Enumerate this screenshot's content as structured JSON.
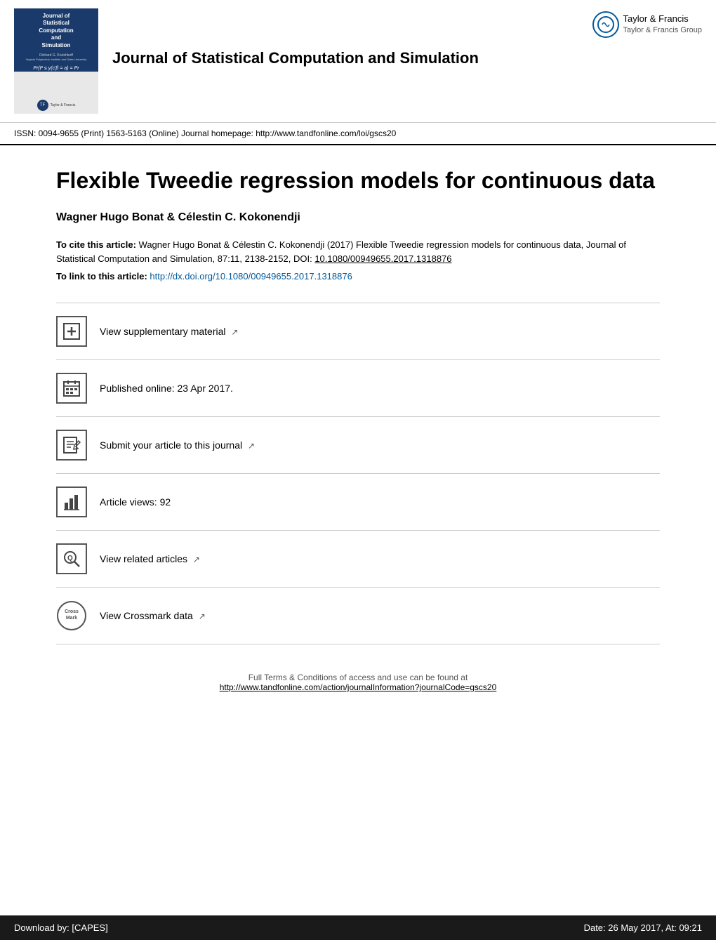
{
  "header": {
    "journal_name": "Journal of Statistical Computation and Simulation",
    "taylor_francis_label": "Taylor & Francis",
    "taylor_francis_group": "Taylor & Francis Group",
    "issn_text": "ISSN: 0094-9655 (Print) 1563-5163 (Online) Journal homepage: http://www.tandfonline.com/loi/gscs20",
    "journal_homepage_url": "http://www.tandfonline.com/loi/gscs20",
    "cover": {
      "title_line1": "Journal of",
      "title_line2": "Statistical",
      "title_line3": "Computation",
      "title_line4": "and",
      "title_line5": "Simulation"
    }
  },
  "article": {
    "title": "Flexible Tweedie regression models for continuous data",
    "authors": "Wagner Hugo Bonat & Célestin C. Kokonendji",
    "cite_label": "To cite this article:",
    "cite_text": "Wagner Hugo Bonat & Célestin C. Kokonendji (2017) Flexible Tweedie regression models for continuous data, Journal of Statistical Computation and Simulation, 87:11, 2138-2152, DOI: 10.1080/00949655.2017.1318876",
    "cite_doi": "10.1080/00949655.2017.1318876",
    "link_label": "To link to this article:",
    "link_url": "http://dx.doi.org/10.1080/00949655.2017.1318876"
  },
  "actions": [
    {
      "id": "supplementary",
      "icon_type": "plus",
      "label": "View supplementary material",
      "has_external_link": true
    },
    {
      "id": "published",
      "icon_type": "calendar",
      "label": "Published online: 23 Apr 2017.",
      "has_external_link": false
    },
    {
      "id": "submit",
      "icon_type": "edit",
      "label": "Submit your article to this journal",
      "has_external_link": true
    },
    {
      "id": "views",
      "icon_type": "chart",
      "label": "Article views: 92",
      "has_external_link": false
    },
    {
      "id": "related",
      "icon_type": "search",
      "label": "View related articles",
      "has_external_link": true
    },
    {
      "id": "crossmark",
      "icon_type": "crossmark",
      "label": "View Crossmark data",
      "has_external_link": true
    }
  ],
  "footer": {
    "full_terms_text": "Full Terms & Conditions of access and use can be found at",
    "full_terms_url": "http://www.tandfonline.com/action/journalInformation?journalCode=gscs20",
    "download_label": "Download by:",
    "download_value": "[CAPES]",
    "date_label": "Date:",
    "date_value": "26 May 2017, At: 09:21"
  }
}
